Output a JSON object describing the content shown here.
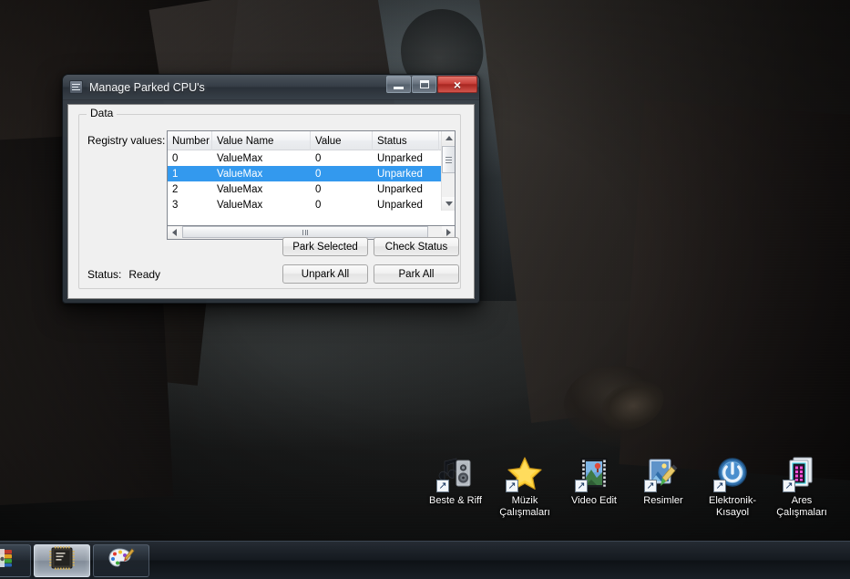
{
  "window": {
    "title": "Manage Parked CPU's",
    "title_icon": "list-document-icon",
    "minimize_label": "Minimize",
    "maximize_label": "Maximize",
    "close_label": "Close",
    "close_glyph": "×"
  },
  "groupbox": {
    "legend": "Data"
  },
  "form": {
    "registry_label": "Registry values:",
    "status_label": "Status:",
    "status_value": "Ready"
  },
  "table": {
    "columns": [
      "Number",
      "Value Name",
      "Value",
      "Status"
    ],
    "rows": [
      {
        "number": "0",
        "value_name": "ValueMax",
        "value": "0",
        "status": "Unparked",
        "selected": false
      },
      {
        "number": "1",
        "value_name": "ValueMax",
        "value": "0",
        "status": "Unparked",
        "selected": true
      },
      {
        "number": "2",
        "value_name": "ValueMax",
        "value": "0",
        "status": "Unparked",
        "selected": false
      },
      {
        "number": "3",
        "value_name": "ValueMax",
        "value": "0",
        "status": "Unparked",
        "selected": false
      }
    ],
    "selection_color": "#3399ee"
  },
  "buttons": {
    "park_selected": "Park Selected",
    "check_status": "Check Status",
    "unpark_all": "Unpark All",
    "park_all": "Park All"
  },
  "desktop_icons": [
    {
      "label": "Beste & Riff",
      "icon": "speaker-music-icon",
      "shortcut": true
    },
    {
      "label": "Müzik Çalışmaları",
      "icon": "star-folder-icon",
      "shortcut": true
    },
    {
      "label": "Video Edit",
      "icon": "film-strip-icon",
      "shortcut": true
    },
    {
      "label": "Resimler",
      "icon": "pictures-brush-icon",
      "shortcut": true
    },
    {
      "label": "Elektronik-Kısayol",
      "icon": "power-button-icon",
      "shortcut": true
    },
    {
      "label": "Ares Çalışmaları",
      "icon": "film-pink-icon",
      "shortcut": true
    }
  ],
  "taskbar": {
    "items": [
      {
        "icon": "winrar-icon",
        "active": false
      },
      {
        "icon": "cpu-chip-icon",
        "active": true
      },
      {
        "icon": "paint-palette-icon",
        "active": false
      }
    ]
  }
}
